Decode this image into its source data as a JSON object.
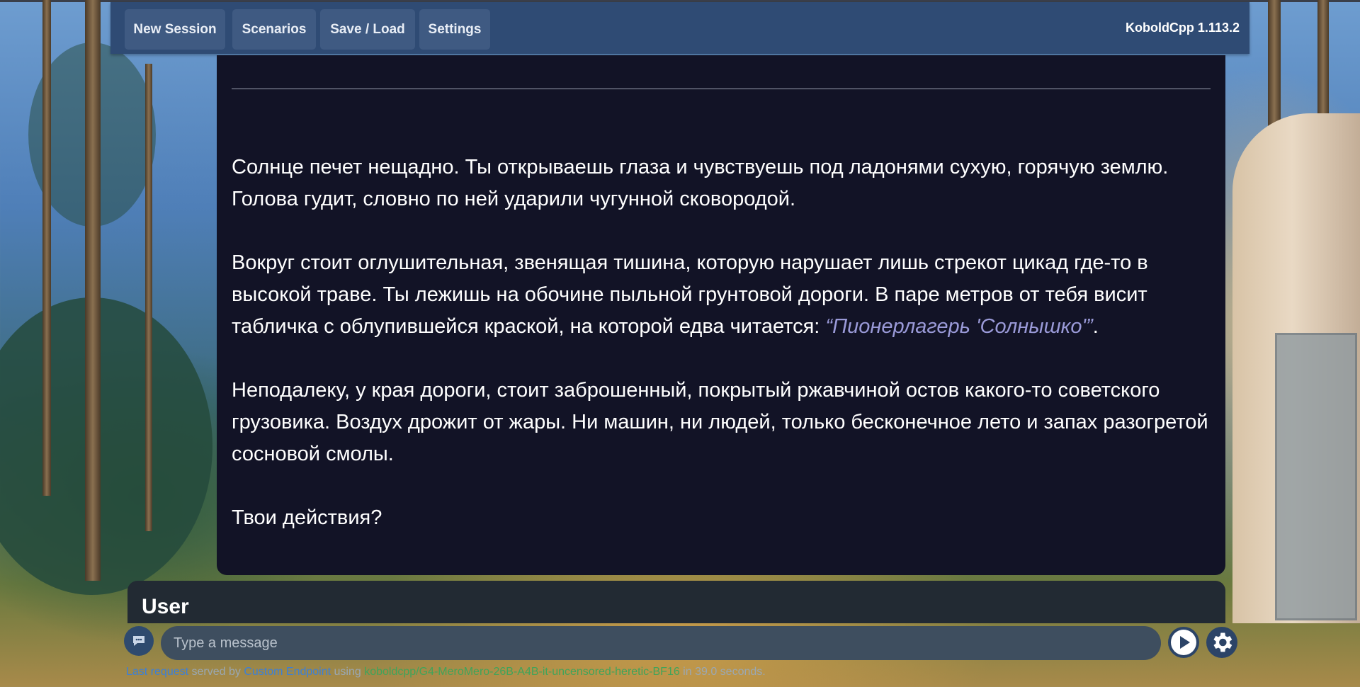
{
  "navbar": {
    "buttons": [
      "New Session",
      "Scenarios",
      "Save / Load",
      "Settings"
    ],
    "version": "KoboldCpp 1.113.2"
  },
  "chat": {
    "paragraph1": "Солнце печет нещадно. Ты открываешь глаза и чувствуешь под ладонями сухую, горячую землю. Голова гудит, словно по ней ударили чугунной сковородой.",
    "paragraph2_text": "Вокруг стоит оглушительная, звенящая тишина, которую нарушает лишь стрекот цикад где-то в высокой траве. Ты лежишь на обочине пыльной грунтовой дороги. В паре метров от тебя висит табличка с облупившейся краской, на которой едва читается: ",
    "paragraph2_quote": "“Пионерлагерь 'Солнышко'”",
    "paragraph2_end": ".",
    "paragraph3": "Неподалеку, у края дороги, стоит заброшенный, покрытый ржавчиной остов какого-то советского грузовика. Воздух дрожит от жары. Ни машин, ни людей, только бесконечное лето и запах разогретой сосновой смолы.",
    "paragraph4": "Твои действия?"
  },
  "user_bar": {
    "label": "User"
  },
  "input": {
    "placeholder": "Type a message"
  },
  "status": {
    "part1": "Last request",
    "part2": " served by ",
    "part3": "Custom Endpoint",
    "part4": " using ",
    "part5": "koboldcpp/G4-MeroMero-26B-A4B-it-uncensored-heretic-BF16",
    "part6": " in 39.0 seconds."
  },
  "icons": {
    "avatar": "chat-bubble-icon",
    "send": "play-send-icon",
    "settings": "gear-icon"
  }
}
